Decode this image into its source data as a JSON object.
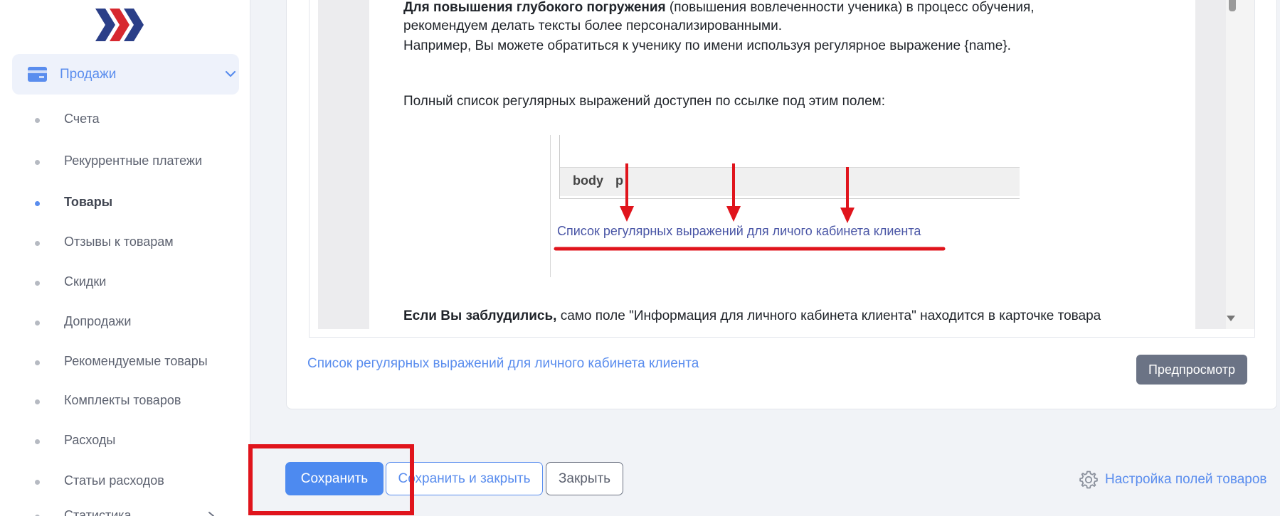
{
  "sidebar": {
    "logo_colors": [
      "#2b3f88",
      "#d7282f"
    ],
    "sales": {
      "label": "Продажи",
      "icon": "credit-card-icon",
      "expanded": true
    },
    "items": [
      {
        "label": "Счета"
      },
      {
        "label": "Рекуррентные платежи"
      },
      {
        "label": "Товары",
        "active": true
      },
      {
        "label": "Отзывы к товарам"
      },
      {
        "label": "Скидки"
      },
      {
        "label": "Допродажи"
      },
      {
        "label": "Рекомендуемые товары"
      },
      {
        "label": "Комплекты товаров"
      },
      {
        "label": "Расходы"
      },
      {
        "label": "Статьи расходов"
      },
      {
        "label": "Статистика"
      }
    ]
  },
  "editor": {
    "line1_bold": "Для повышения глубокого погружения",
    "line1_rest": " (повышения вовлеченности ученика) в процесс обучения,",
    "line2": "рекомендуем делать тексты более персонализированными.",
    "line3": "Например, Вы можете обратиться к ученику по имени используя регулярное выражение {name}.",
    "line4": "Полный список регулярных выражений доступен по ссылке под этим полем:",
    "inner_image": {
      "body_label": "body",
      "p_label": "p",
      "link_text": "Список регулярных выражений для личого кабинета клиента"
    },
    "line5_bold": "Если Вы заблудились,",
    "line5_rest": " само поле \"Информация для личного кабинета клиента\" находится в карточке товара"
  },
  "regex_link": "Список регулярных выражений для личного кабинета клиента",
  "preview_button": "Предпросмотр",
  "actions": {
    "save": "Сохранить",
    "save_close": "Сохранить и закрыть",
    "close": "Закрыть"
  },
  "settings_link": {
    "label": "Настройка полей товаров",
    "icon": "gear-icon"
  },
  "colors": {
    "accent": "#5a8dee",
    "save_button": "#4d8af0",
    "preview_button": "#6b7385",
    "highlight_red": "#e0141c"
  }
}
